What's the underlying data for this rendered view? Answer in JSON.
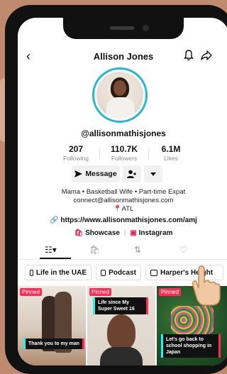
{
  "header": {
    "title": "Allison Jones"
  },
  "profile": {
    "handle": "@allisonmathisjones"
  },
  "stats": [
    {
      "value": "207",
      "label": "Following"
    },
    {
      "value": "110.7K",
      "label": "Followers"
    },
    {
      "value": "6.1M",
      "label": "Likes"
    }
  ],
  "buttons": {
    "message": "Message"
  },
  "bio": {
    "line1": "Mama • Basketball Wife • Part-time Expat",
    "line2": "connect@allisonmathisjones.com",
    "line3": "ATL"
  },
  "link": "https://www.allisonmathisjones.com/amj",
  "social": {
    "showcase": "Showcase",
    "instagram": "Instagram"
  },
  "playlists": [
    {
      "label": "Life in the UAE"
    },
    {
      "label": "Podcast"
    },
    {
      "label": "Harper's Height"
    }
  ],
  "videos": [
    {
      "pinned": "Pinned",
      "caption": "Thank you to my man"
    },
    {
      "pinned": "Pinned",
      "caption": "Life since My Super Sweet 16"
    },
    {
      "pinned": "Pinned",
      "caption": "Let's go back to school shopping in Japan"
    }
  ],
  "colors": {
    "accent_red": "#fe2c55",
    "accent_cyan": "#25f4ee",
    "avatar_ring": "#22b8cf",
    "background": "#c08a6f"
  }
}
